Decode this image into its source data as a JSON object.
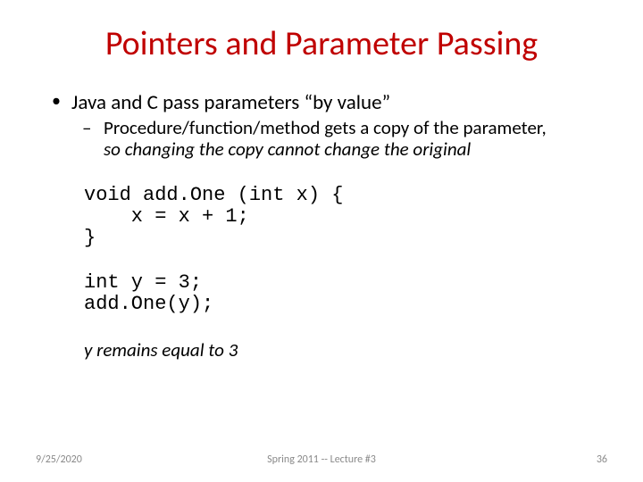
{
  "title": "Pointers and Parameter Passing",
  "bullet1": "Java and C pass parameters “by value”",
  "bullet2a": "Procedure/function/method gets a copy of the parameter, ",
  "bullet2b": "so changing the copy cannot change the original",
  "code1": "void add.One (int x) {\n    x = x + 1;\n}",
  "code2": "int y = 3;\nadd.One(y);",
  "conclusion": "y remains equal to 3",
  "footer": {
    "date": "9/25/2020",
    "center": "Spring 2011 -- Lecture #3",
    "page": "36"
  }
}
